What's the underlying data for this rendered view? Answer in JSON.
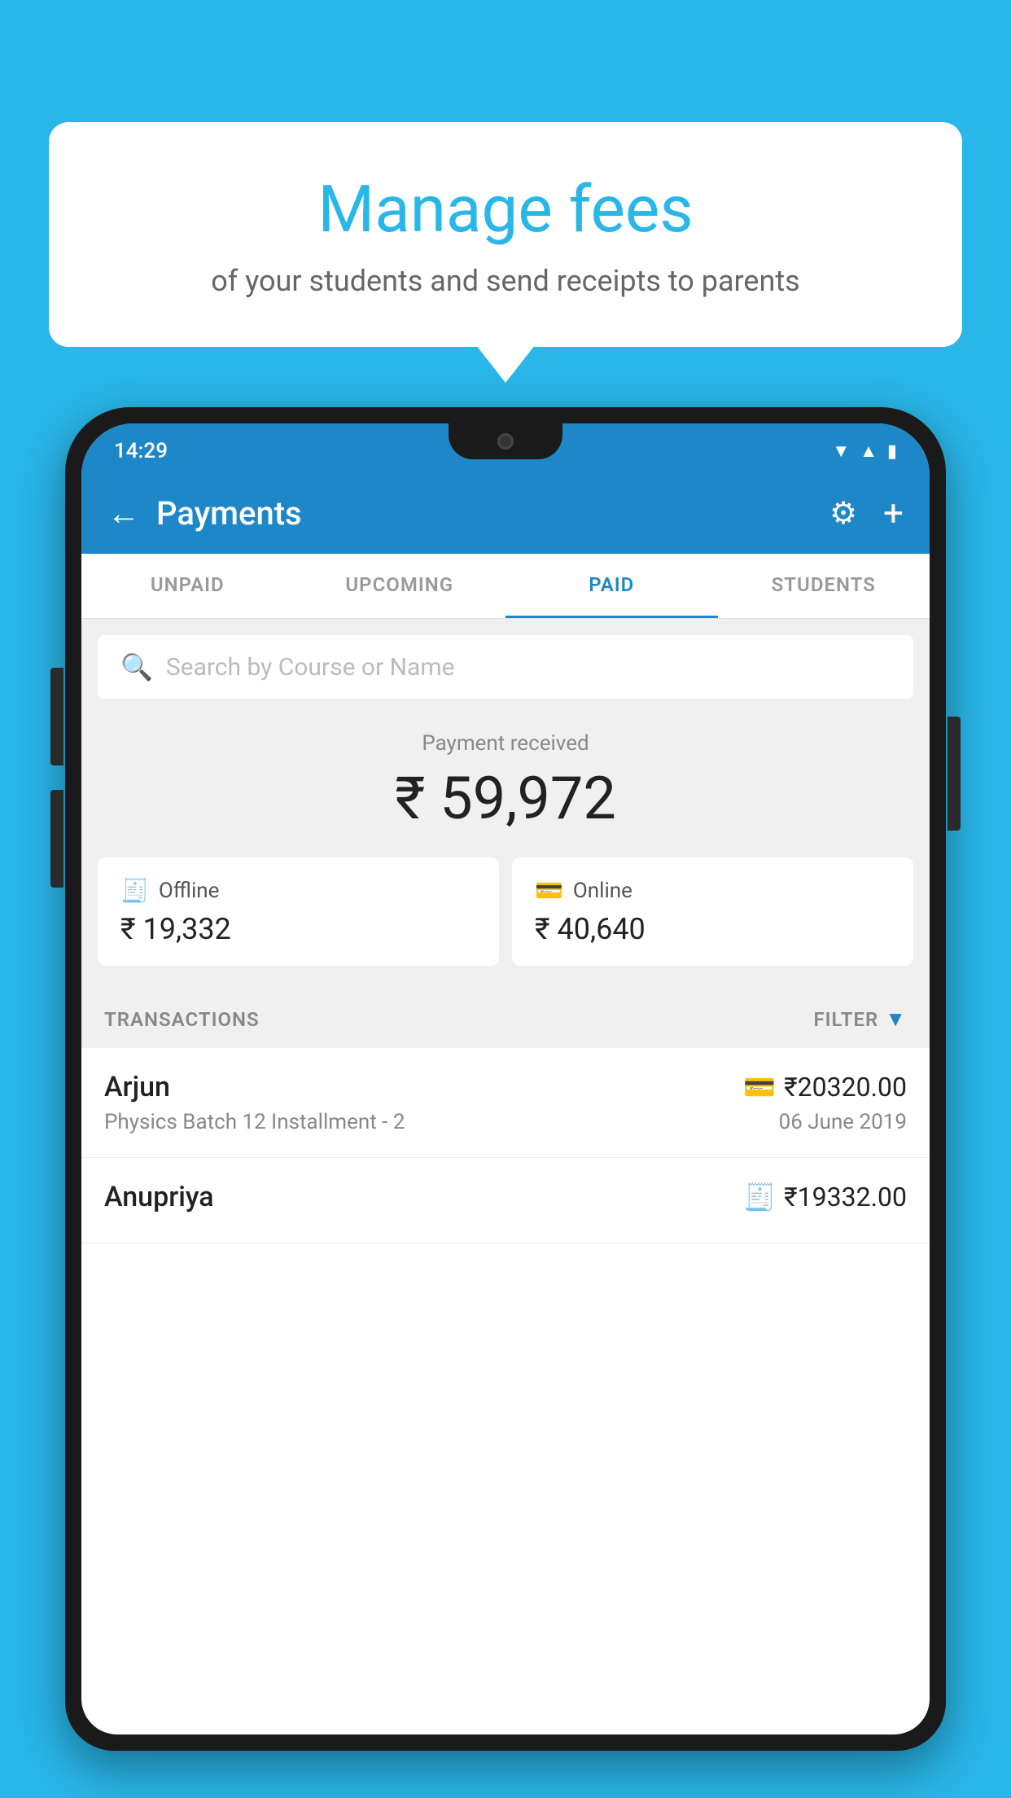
{
  "background_color": "#29b6e8",
  "bubble": {
    "title": "Manage fees",
    "subtitle": "of your students and send receipts to parents"
  },
  "phone": {
    "status_bar": {
      "time": "14:29",
      "icons": [
        "wifi",
        "signal",
        "battery"
      ]
    },
    "app_bar": {
      "title": "Payments",
      "back_label": "←",
      "gear_label": "⚙",
      "add_label": "+"
    },
    "tabs": [
      {
        "label": "UNPAID",
        "active": false
      },
      {
        "label": "UPCOMING",
        "active": false
      },
      {
        "label": "PAID",
        "active": true
      },
      {
        "label": "STUDENTS",
        "active": false
      }
    ],
    "search": {
      "placeholder": "Search by Course or Name"
    },
    "payment_received": {
      "label": "Payment received",
      "amount": "₹ 59,972"
    },
    "payment_cards": [
      {
        "label": "Offline",
        "amount": "₹ 19,332",
        "icon": "offline"
      },
      {
        "label": "Online",
        "amount": "₹ 40,640",
        "icon": "online"
      }
    ],
    "transactions_section": {
      "label": "TRANSACTIONS",
      "filter_label": "FILTER"
    },
    "transactions": [
      {
        "name": "Arjun",
        "amount": "₹20320.00",
        "course": "Physics Batch 12 Installment - 2",
        "date": "06 June 2019",
        "payment_type": "card"
      },
      {
        "name": "Anupriya",
        "amount": "₹19332.00",
        "course": "",
        "date": "",
        "payment_type": "offline"
      }
    ]
  }
}
